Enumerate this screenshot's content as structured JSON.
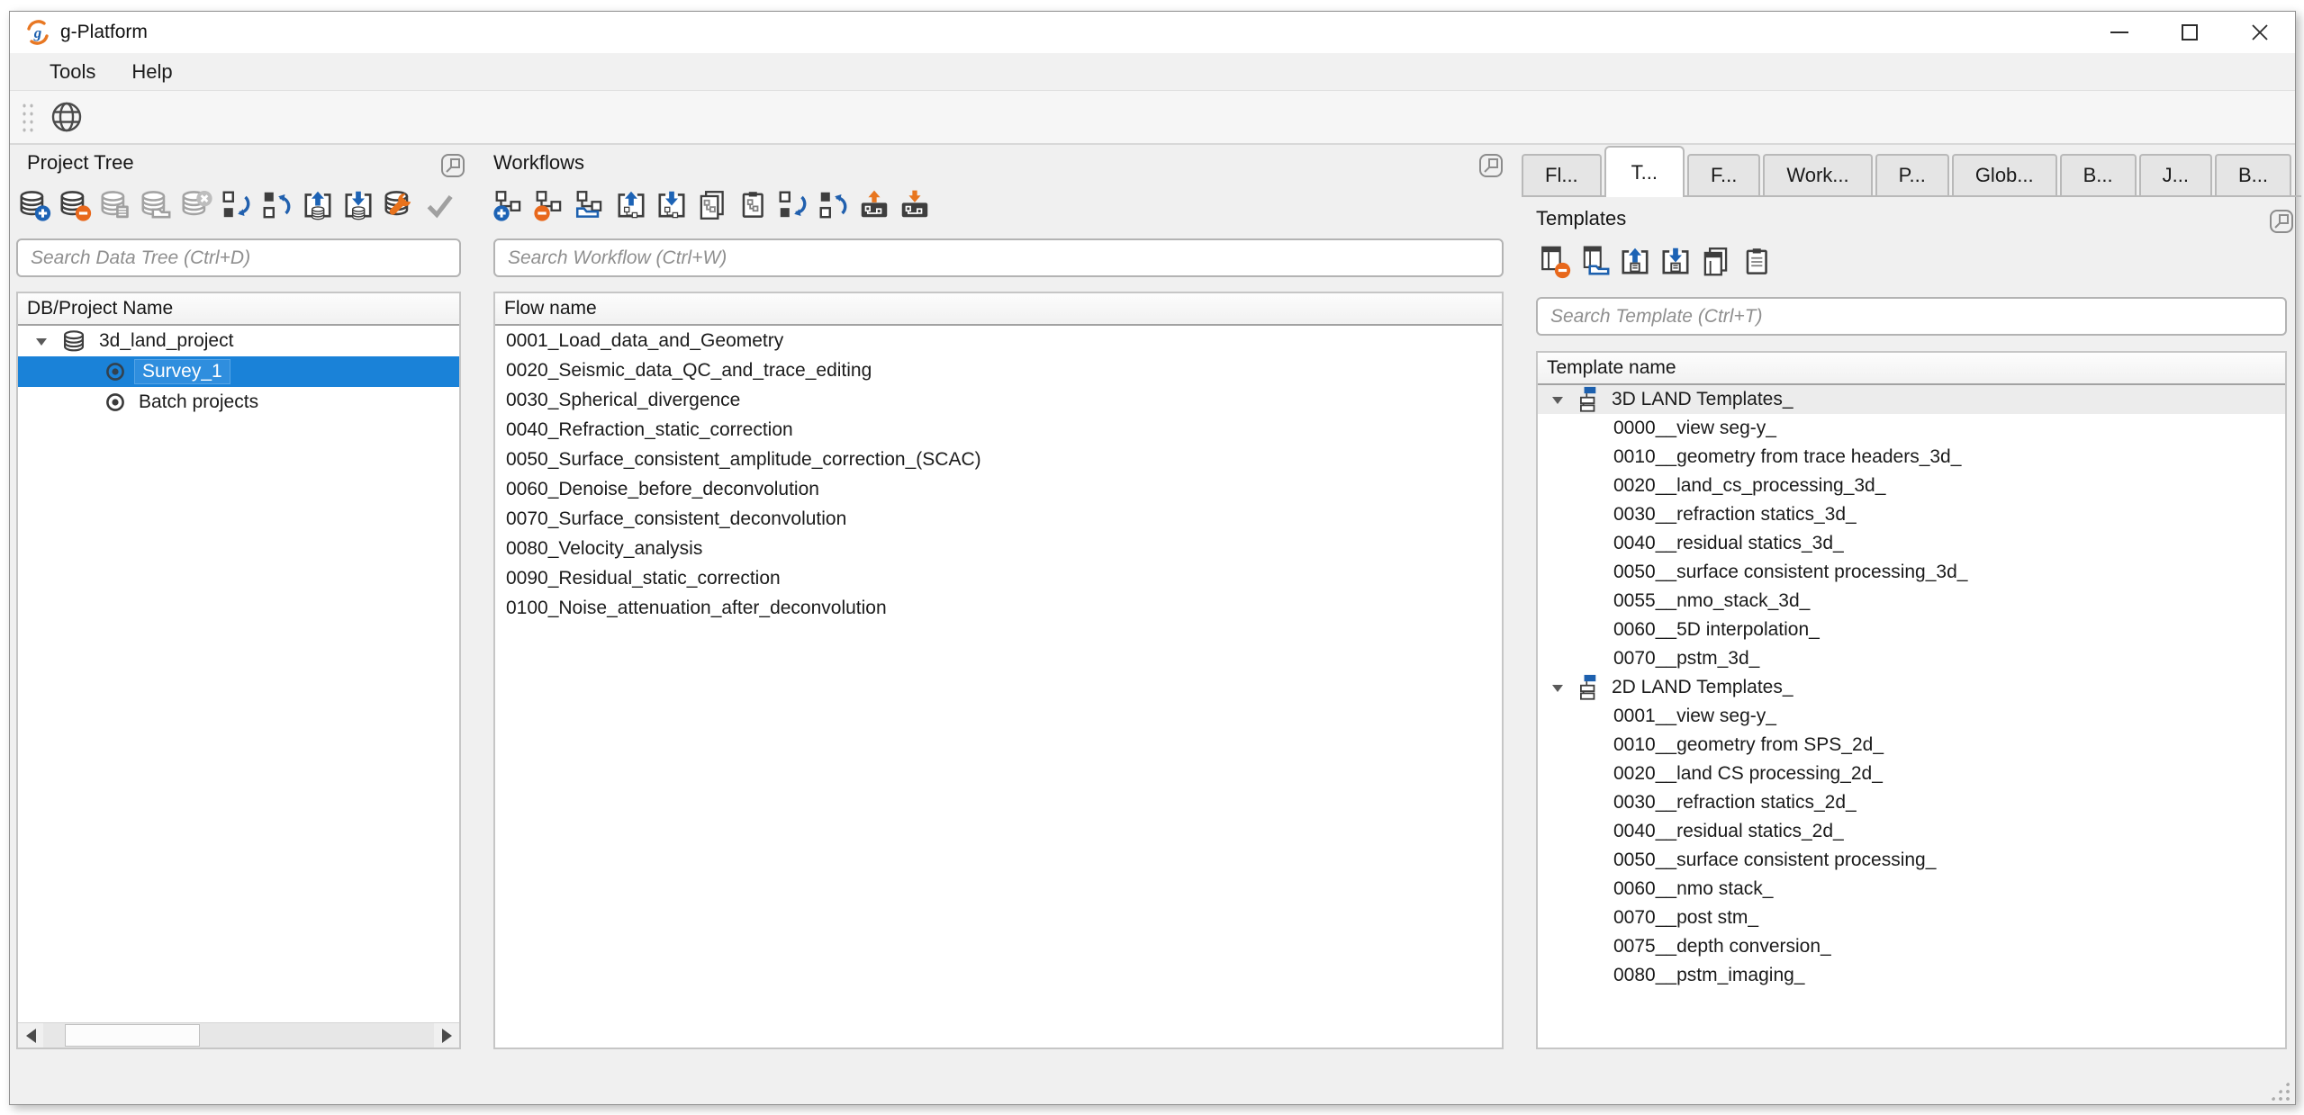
{
  "window": {
    "title": "g-Platform",
    "controls": [
      "minimize-icon",
      "maximize-icon",
      "close-icon"
    ]
  },
  "menu": {
    "items": [
      "Tools",
      "Help"
    ]
  },
  "main_toolbar": {
    "icons": [
      "globe-icon"
    ]
  },
  "project_tree": {
    "title": "Project Tree",
    "toolbar_icons": [
      "add-database",
      "remove-database",
      "database-properties",
      "open-database",
      "close-database",
      "undo",
      "redo",
      "export-database",
      "import-database",
      "repair-database",
      "validate-database"
    ],
    "search": {
      "placeholder": "Search Data Tree (Ctrl+D)"
    },
    "column_header": "DB/Project Name",
    "rows": [
      {
        "label": "3d_land_project",
        "level": 0,
        "icon": "database-icon",
        "expanded": true,
        "selected": false
      },
      {
        "label": "Survey_1",
        "level": 1,
        "icon": "radio-icon",
        "selected": true
      },
      {
        "label": "Batch projects",
        "level": 1,
        "icon": "radio-icon",
        "selected": false
      }
    ]
  },
  "workflows": {
    "title": "Workflows",
    "toolbar_icons": [
      "add-workflow",
      "remove-workflow",
      "open-workflow",
      "export-workflow",
      "import-workflow",
      "copy-workflow",
      "paste-workflow",
      "undo",
      "redo",
      "export-workflow-archive",
      "import-workflow-archive"
    ],
    "search": {
      "placeholder": "Search Workflow (Ctrl+W)"
    },
    "column_header": "Flow name",
    "flows": [
      "0001_Load_data_and_Geometry",
      "0020_Seismic_data_QC_and_trace_editing",
      "0030_Spherical_divergence",
      "0040_Refraction_static_correction",
      "0050_Surface_consistent_amplitude_correction_(SCAC)",
      "0060_Denoise_before_deconvolution",
      "0070_Surface_consistent_deconvolution",
      "0080_Velocity_analysis",
      "0090_Residual_static_correction",
      "0100_Noise_attenuation_after_deconvolution"
    ]
  },
  "right_panel": {
    "tabs": [
      {
        "label": "Fl...",
        "active": false
      },
      {
        "label": "T...",
        "active": true
      },
      {
        "label": "F...",
        "active": false
      },
      {
        "label": "Work...",
        "active": false
      },
      {
        "label": "P...",
        "active": false
      },
      {
        "label": "Glob...",
        "active": false
      },
      {
        "label": "B...",
        "active": false
      },
      {
        "label": "J...",
        "active": false
      },
      {
        "label": "B...",
        "active": false
      }
    ],
    "templates": {
      "title": "Templates",
      "toolbar_icons": [
        "remove-template",
        "open-template",
        "export-template",
        "import-template",
        "copy-template",
        "paste-template"
      ],
      "search": {
        "placeholder": "Search Template (Ctrl+T)"
      },
      "column_header": "Template name",
      "groups": [
        {
          "label": "3D LAND Templates_",
          "expanded": true,
          "highlighted": true,
          "items": [
            "0000__view seg-y_",
            "0010__geometry from trace headers_3d_",
            "0020__land_cs_processing_3d_",
            "0030__refraction statics_3d_",
            "0040__residual statics_3d_",
            "0050__surface consistent processing_3d_",
            "0055__nmo_stack_3d_",
            "0060__5D interpolation_",
            "0070__pstm_3d_"
          ]
        },
        {
          "label": "2D LAND Templates_",
          "expanded": true,
          "highlighted": false,
          "items": [
            "0001__view seg-y_",
            "0010__geometry from SPS_2d_",
            "0020__land CS processing_2d_",
            "0030__refraction statics_2d_",
            "0040__residual statics_2d_",
            "0050__surface consistent processing_",
            "0060__nmo stack_",
            "0070__post stm_",
            "0075__depth conversion_",
            "0080__pstm_imaging_"
          ]
        }
      ]
    }
  }
}
